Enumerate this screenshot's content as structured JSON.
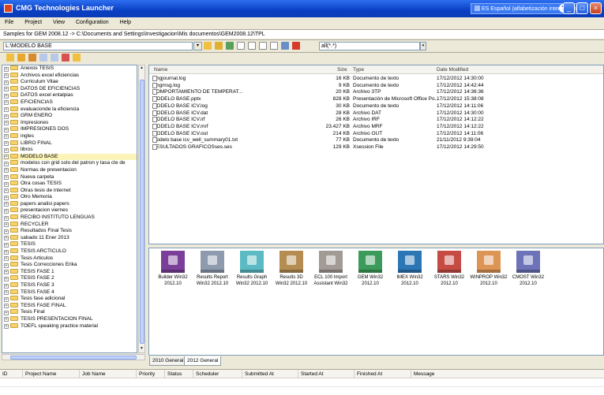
{
  "window": {
    "title": "CMG Technologies Launcher",
    "language": "ES Español (alfabetización internacional)",
    "help_label": "?",
    "buttons": [
      "_",
      "□",
      "×"
    ]
  },
  "menu": [
    "File",
    "Project",
    "View",
    "Configuration",
    "Help"
  ],
  "samples_path": "Samples for GEM 2008.12 -> C:\\Documents and Settings\\Investigacion\\Mis documentos\\GEM2008.12\\TPL",
  "path_value": "L:\\MODELO BASE",
  "filter_value": "all(*.*)",
  "tree": [
    {
      "label": "Anexos TESIS"
    },
    {
      "label": "Archivos excel eficiencias"
    },
    {
      "label": "Curriculum Vitae"
    },
    {
      "label": "DATOS DE EFICIENCIAS"
    },
    {
      "label": "DATOS excel entalpias"
    },
    {
      "label": "EFICIENCIAS"
    },
    {
      "label": "evaluacionde la eficiencia"
    },
    {
      "label": "GRM ENERO"
    },
    {
      "label": "Impresiones"
    },
    {
      "label": "IMPRESIONES DOS"
    },
    {
      "label": "ingles"
    },
    {
      "label": "LIBRO FINAL"
    },
    {
      "label": "libros"
    },
    {
      "label": "MODELO BASE",
      "selected": true
    },
    {
      "label": "modelos con grid solo del patron  y tasa cte de"
    },
    {
      "label": "Normas de presentacion"
    },
    {
      "label": "Nueva carpeta"
    },
    {
      "label": "Otra cosas TESIS"
    },
    {
      "label": "Otras tesis de internet"
    },
    {
      "label": "Otro Memoria"
    },
    {
      "label": "papers analisi papers"
    },
    {
      "label": "presentacion viernes"
    },
    {
      "label": "RECIBO INSTITUTO LENGUAS"
    },
    {
      "label": "RECYCLER"
    },
    {
      "label": "Resultados Final Tesis"
    },
    {
      "label": "sabado 11 Ener 2013"
    },
    {
      "label": "TESIS"
    },
    {
      "label": "TESIS ARCTICULO"
    },
    {
      "label": "Tesis Articulos"
    },
    {
      "label": "Tesis Correcciones Erika"
    },
    {
      "label": "TESIS FASE 1"
    },
    {
      "label": "TESIS FASE 2"
    },
    {
      "label": "TESIS FASE 3"
    },
    {
      "label": "TESIS FASE 4"
    },
    {
      "label": "Tesis fase adicional"
    },
    {
      "label": "TESIS FASE FINAL"
    },
    {
      "label": "Tesis Final"
    },
    {
      "label": "TESIS PRESENTACION FINAL"
    },
    {
      "label": "TOEFL speaking practice material"
    }
  ],
  "file_columns": {
    "name": "Name",
    "size": "Size",
    "type": "Type",
    "date": "Date Modified"
  },
  "files": [
    {
      "name": "cmgjournal.log",
      "size": "16 KB",
      "type": "Documento de texto",
      "date": "17/12/2012 14:30:00"
    },
    {
      "name": "cmgmsg.log",
      "size": "9 KB",
      "type": "Documento de texto",
      "date": "17/12/2012 14:42:44"
    },
    {
      "name": "COMPORTAMIENTO DE TEMPERAT...",
      "size": "20 KB",
      "type": "Archivo 3TP",
      "date": "17/12/2012 14:36:36"
    },
    {
      "name": "MODELO BASE.pptx",
      "size": "828 KB",
      "type": "Presentación de Microsoft Office Po...",
      "date": "17/12/2012 15:38:08"
    },
    {
      "name": "MODELO BASE ICV.log",
      "size": "30 KB",
      "type": "Documento de texto",
      "date": "17/12/2012 14:11:06"
    },
    {
      "name": "MODELO BASE ICV.dat",
      "size": "28 KB",
      "type": "Archivo DAT",
      "date": "17/12/2012 14:30:00"
    },
    {
      "name": "MODELO BASE ICV.irf",
      "size": "26 KB",
      "type": "Archivo IRF",
      "date": "17/12/2012 14:12:22"
    },
    {
      "name": "MODELO BASE ICV.mrf",
      "size": "23.427 KB",
      "type": "Archivo MRF",
      "date": "17/12/2012 14:12:22"
    },
    {
      "name": "MODELO BASE ICV.out",
      "size": "214 KB",
      "type": "Archivo OUT",
      "date": "17/12/2012 14:11:06"
    },
    {
      "name": "modelo base icv_well_summary01.txt",
      "size": "77 KB",
      "type": "Documento de texto",
      "date": "21/11/2012 9:39:04"
    },
    {
      "name": "RESULTADOS GRAFICOSses.ses",
      "size": "129 KB",
      "type": "Xsession File",
      "date": "17/12/2012 14:29:50"
    }
  ],
  "apps": [
    {
      "name": "Builder Win32",
      "version": "2012.10",
      "color": "#7b3f9a"
    },
    {
      "name": "Results Report",
      "version": "Win32 2012.10",
      "color": "#8e9aae"
    },
    {
      "name": "Results Graph",
      "version": "Win32 2012.10",
      "color": "#5bbac4"
    },
    {
      "name": "Results 3D",
      "version": "Win32 2012.10",
      "color": "#b58d52"
    },
    {
      "name": "ECL 100 Import",
      "version": "Assistant Win32",
      "color": "#a19a95"
    },
    {
      "name": "GEM Win32",
      "version": "2012.10",
      "color": "#3c9b5a"
    },
    {
      "name": "IMEX Win32",
      "version": "2012.10",
      "color": "#2d76b6"
    },
    {
      "name": "STARS Win32",
      "version": "2012.10",
      "color": "#c54b43"
    },
    {
      "name": "WINPROP Win32",
      "version": "2012.10",
      "color": "#dd9555"
    },
    {
      "name": "CMOST Win32",
      "version": "2012.10",
      "color": "#6d73b8"
    }
  ],
  "tabs": [
    "2010 General",
    "2012 General"
  ],
  "job_columns": [
    "ID",
    "Project Name",
    "Job Name",
    "Priority",
    "Status",
    "Scheduler",
    "Submitted At",
    "Started At",
    "Finished At",
    "Message"
  ]
}
